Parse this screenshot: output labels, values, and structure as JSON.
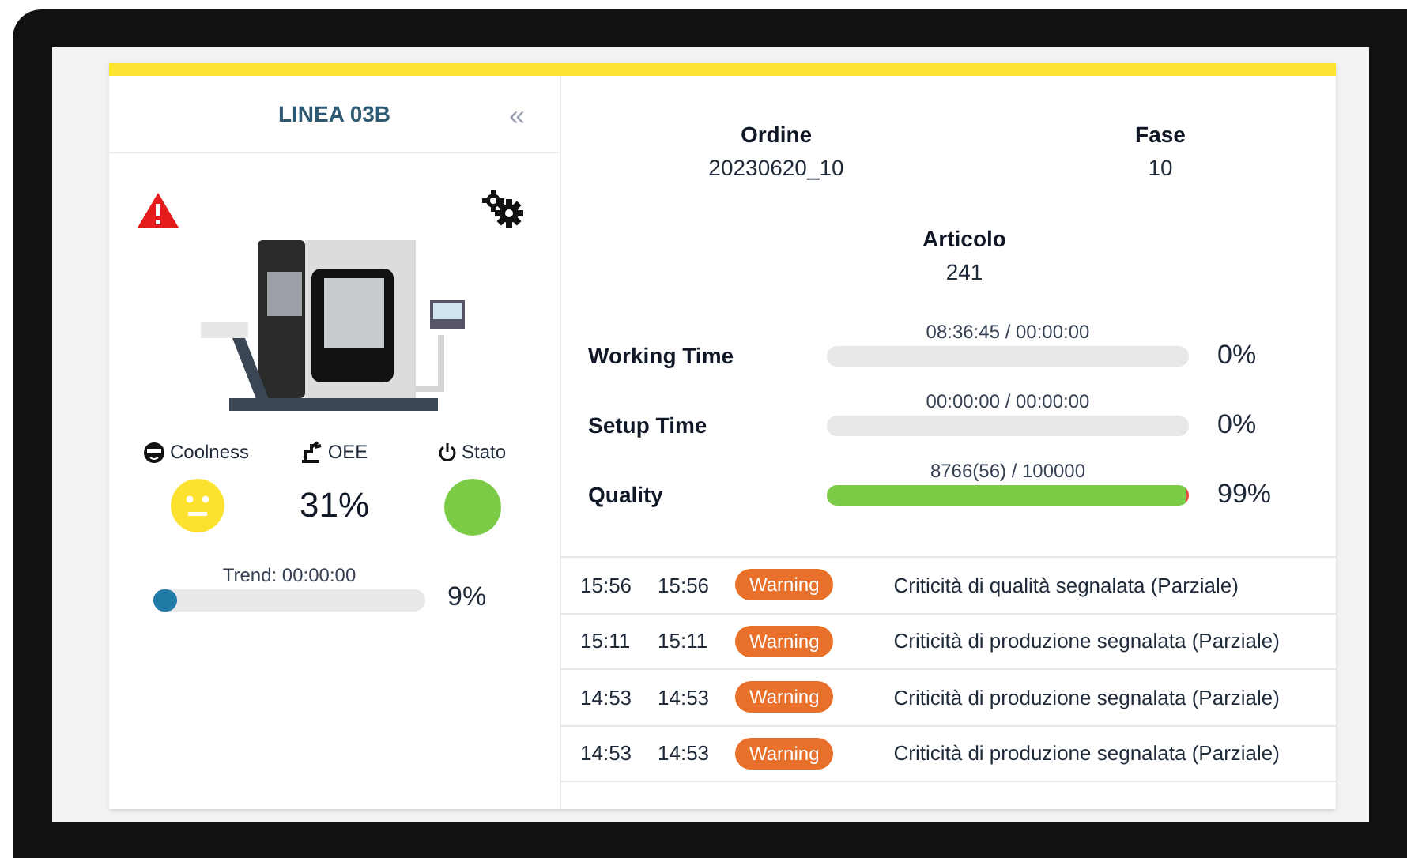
{
  "line": {
    "title": "LINEA 03B",
    "collapse_icon": "«",
    "alarm": true
  },
  "indicators": {
    "coolness": {
      "label": "Coolness",
      "color": "#fce22e"
    },
    "oee": {
      "label": "OEE",
      "value": "31%"
    },
    "stato": {
      "label": "Stato",
      "color": "#7ccb46"
    }
  },
  "trend": {
    "label": "Trend: 00:00:00",
    "level": 0.09,
    "reading": "9%"
  },
  "order": {
    "ordine_label": "Ordine",
    "ordine": "20230620_10",
    "fase_label": "Fase",
    "fase": "10",
    "articolo_label": "Articolo",
    "articolo": "241"
  },
  "metrics": [
    {
      "label": "Working Time",
      "caption": "08:36:45 / 00:00:00",
      "level": 0,
      "reading": "0%"
    },
    {
      "label": "Setup Time",
      "caption": "00:00:00 / 00:00:00",
      "level": 0,
      "reading": "0%"
    },
    {
      "label": "Quality",
      "caption": "8766(56) / 100000",
      "level": 0.99,
      "reading": "99%"
    }
  ],
  "events": [
    {
      "start": "15:56",
      "end": "15:56",
      "badge": "Warning",
      "kind": "warning",
      "message": "Criticità di qualità segnalata (Parziale)"
    },
    {
      "start": "15:11",
      "end": "15:11",
      "badge": "Warning",
      "kind": "warning",
      "message": "Criticità di produzione segnalata (Parziale)"
    },
    {
      "start": "14:53",
      "end": "14:53",
      "badge": "Warning",
      "kind": "warning",
      "message": "Criticità di produzione segnalata (Parziale)"
    },
    {
      "start": "14:53",
      "end": "14:53",
      "badge": "Warning",
      "kind": "warning",
      "message": "Criticità di produzione segnalata (Parziale)"
    }
  ]
}
